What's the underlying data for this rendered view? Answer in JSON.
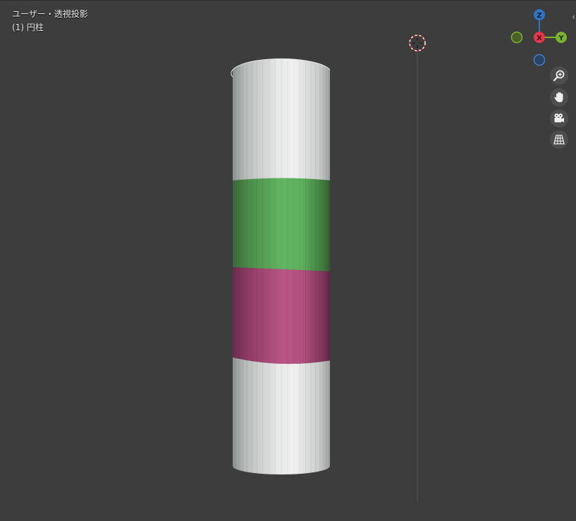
{
  "viewport": {
    "view_label": "ユーザー・透視投影",
    "object_label": "(1) 円柱"
  },
  "axis_gizmo": {
    "z_label": "Z",
    "x_label": "X",
    "y_label": "Y",
    "colors": {
      "z": "#2f73c7",
      "x": "#e8374a",
      "y": "#7ab32c",
      "neg_y": "#5a7a28",
      "neg_z": "#25497a"
    }
  },
  "tools": [
    {
      "name": "zoom-icon"
    },
    {
      "name": "hand-pan-icon"
    },
    {
      "name": "camera-icon"
    },
    {
      "name": "perspective-grid-icon"
    }
  ],
  "cylinder": {
    "bands": [
      {
        "name": "top-white",
        "color": "#d8dcd9"
      },
      {
        "name": "green",
        "color": "#5aaa5a"
      },
      {
        "name": "magenta",
        "color": "#b2507f"
      },
      {
        "name": "bottom-white",
        "color": "#d8dcd9"
      }
    ]
  },
  "collapse_arrow": "‹"
}
